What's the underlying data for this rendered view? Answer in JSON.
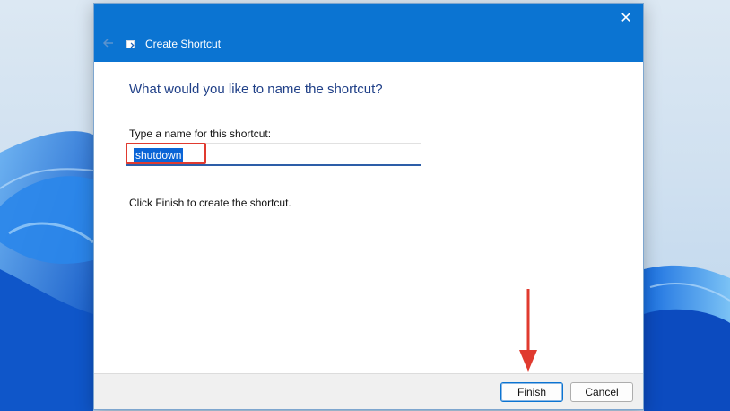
{
  "dialog": {
    "title": "Create Shortcut",
    "close_icon": "close-icon",
    "back_icon": "back-arrow-icon",
    "heading": "What would you like to name the shortcut?",
    "field_label": "Type a name for this shortcut:",
    "field_value": "shutdown",
    "hint": "Click Finish to create the shortcut.",
    "finish_label": "Finish",
    "cancel_label": "Cancel"
  },
  "colors": {
    "titlebar": "#0b74d2",
    "heading": "#1f3f87",
    "selection": "#0a64d6",
    "annotation": "#e03a2f"
  }
}
